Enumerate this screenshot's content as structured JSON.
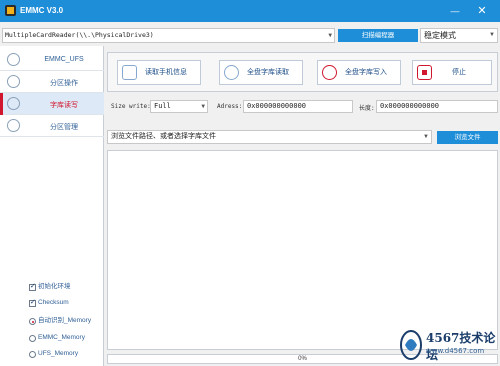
{
  "window": {
    "title": "EMMC V3.0",
    "minimize": "—",
    "close": "✕"
  },
  "toolbar": {
    "drive": "MultipleCardReader(\\\\.\\PhysicalDrive3)",
    "scan_label": "扫描编程器",
    "mode": "稳定模式"
  },
  "sidebar": {
    "items": [
      {
        "label": "EMMC_UFS",
        "active": false
      },
      {
        "label": "分区操作",
        "active": false
      },
      {
        "label": "字库读写",
        "active": true
      },
      {
        "label": "分区管理",
        "active": false
      }
    ],
    "options": [
      {
        "type": "checkbox",
        "label": "初始化环境",
        "checked": true
      },
      {
        "type": "checkbox",
        "label": "Checksum",
        "checked": true
      },
      {
        "type": "radio",
        "label": "自动识别_Memory",
        "selected": true
      },
      {
        "type": "radio",
        "label": "EMMC_Memory",
        "selected": false
      },
      {
        "type": "radio",
        "label": "UFS_Memory",
        "selected": false
      }
    ]
  },
  "actions": [
    {
      "label": "读取手机信息"
    },
    {
      "label": "全盘字库读取"
    },
    {
      "label": "全盘字库写入"
    },
    {
      "label": "停止"
    }
  ],
  "params": {
    "size_label": "Size write:",
    "size_value": "Full",
    "address_label": "Adress:",
    "address_value": "0x000000000000",
    "length_label": "长度:",
    "length_value": "0x000000000000"
  },
  "file": {
    "placeholder": "浏览文件路径、或者选择字库文件",
    "browse_label": "浏览文件"
  },
  "progress": {
    "percent": 0,
    "label": "0%"
  },
  "watermark": {
    "title": "4567技术论坛",
    "url": "www.d4567.com"
  },
  "colors": {
    "accent": "#1e8ed8",
    "active": "#d0172e",
    "nav_text": "#2f5f96"
  }
}
